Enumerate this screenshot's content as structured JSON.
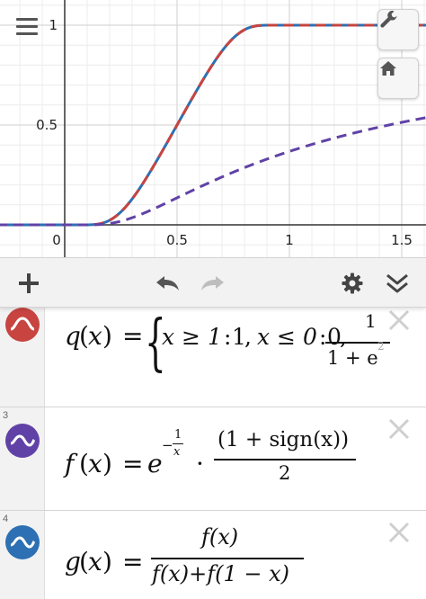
{
  "graph": {
    "x_ticks": [
      "0",
      "0.5",
      "1",
      "1.5"
    ],
    "y_ticks": [
      "1",
      "0.5"
    ],
    "view": {
      "xmin": -0.25,
      "xmax": 1.6,
      "ymin": -0.1,
      "ymax": 1.05
    },
    "series": [
      {
        "expr": "g",
        "color": "#2d70b3",
        "style": "solid"
      },
      {
        "expr": "q",
        "color": "#c74440",
        "style": "dashed"
      },
      {
        "expr": "f",
        "color": "#6042a6",
        "style": "dashed"
      }
    ]
  },
  "toolbar": {
    "add_icon": "plus-icon",
    "undo_icon": "undo-icon",
    "redo_icon": "redo-icon",
    "settings_icon": "gear-icon",
    "collapse_icon": "double-chevron-down-icon"
  },
  "expressions": [
    {
      "number": "",
      "color": "#c74440",
      "name": "q",
      "var": "x",
      "eq": "=",
      "brace": "{",
      "cond1": "x ≥ 1",
      "val1": "1",
      "cond2": "x ≤ 0",
      "val2": "0",
      "frac_num": "1",
      "frac_den_base": "1 + e",
      "frac_den_exp": "2"
    },
    {
      "number": "3",
      "color": "#6042a6",
      "name": "f",
      "var": "x",
      "eq": "=",
      "base": "e",
      "exp_sign": "−",
      "exp_num": "1",
      "exp_den": "x",
      "dot": "·",
      "frac_num": "(1 + sign(x))",
      "frac_den": "2"
    },
    {
      "number": "4",
      "color": "#2d70b3",
      "name": "g",
      "var": "x",
      "eq": "=",
      "frac_num": "f(x)",
      "frac_den": "f(x)+f(1 − x)"
    }
  ]
}
